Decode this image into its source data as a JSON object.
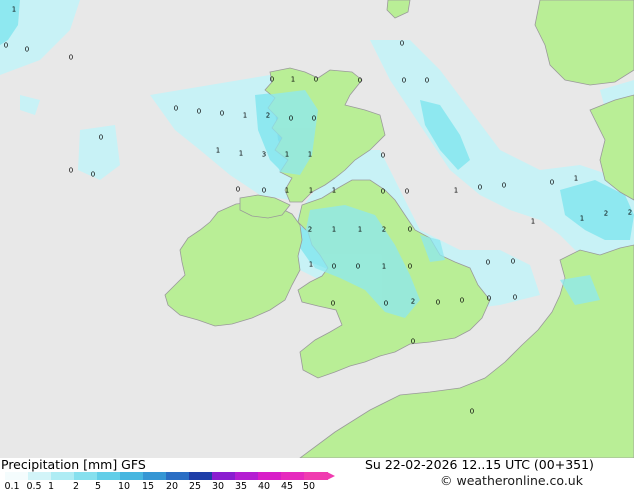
{
  "map": {
    "colors": {
      "sea": "#e8e8e8",
      "land": "#b9ee96",
      "coast": "#9a9a9a",
      "precip_light": "#c8f2f6",
      "precip_mid": "#8ee8f0",
      "precip_heavy": "#5bc8e6"
    },
    "precip_values": [
      "1",
      "0",
      "0",
      "0",
      "0",
      "1",
      "0",
      "0",
      "0",
      "0",
      "0",
      "0",
      "0",
      "0",
      "1",
      "2",
      "0",
      "0",
      "0",
      "1",
      "1",
      "3",
      "1",
      "1",
      "0",
      "0",
      "0",
      "0",
      "0",
      "1",
      "1",
      "1",
      "0",
      "0",
      "1",
      "0",
      "0",
      "0",
      "1",
      "2",
      "1",
      "1",
      "2",
      "2",
      "2",
      "0",
      "1",
      "1",
      "1",
      "0",
      "0",
      "1",
      "0",
      "0",
      "0",
      "2",
      "0",
      "0",
      "0",
      "0",
      "0",
      "0",
      "0",
      "0"
    ]
  },
  "footer": {
    "title": "Precipitation [mm]  GFS",
    "datetime": "Su 22-02-2026 12..15 UTC (00+351)",
    "copyright": "© weatheronline.co.uk",
    "legend_ticks": [
      "0.1",
      "0.5",
      "1",
      "2",
      "5",
      "10",
      "15",
      "20",
      "25",
      "30",
      "35",
      "40",
      "45",
      "50"
    ],
    "legend_colors": [
      "#f4fcfd",
      "#d2f4f8",
      "#aeecf4",
      "#86e0ee",
      "#62cee8",
      "#46b6e0",
      "#3596d4",
      "#2a6ec4",
      "#1e3ea8",
      "#8a1ed0",
      "#b41ed2",
      "#d81ec8",
      "#e62abe",
      "#f03cb0"
    ]
  }
}
